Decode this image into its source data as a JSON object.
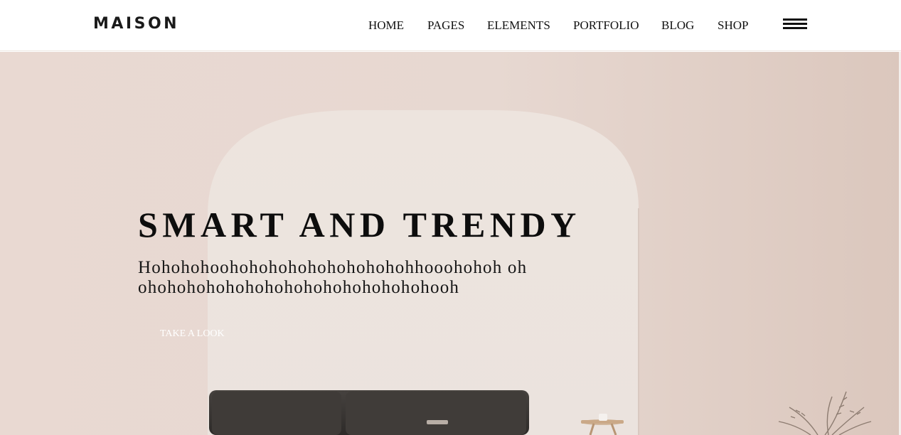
{
  "header": {
    "logo": "MAISON",
    "nav": [
      {
        "label": "HOME"
      },
      {
        "label": "PAGES"
      },
      {
        "label": "ELEMENTS"
      },
      {
        "label": "PORTFOLIO"
      },
      {
        "label": "BLOG"
      },
      {
        "label": "SHOP"
      }
    ],
    "menu_icon": "hamburger-menu-icon"
  },
  "hero": {
    "title": "SMART AND TRENDY",
    "subtitle": "Hohohohoohohohohohohohohohohhooohohoh ohohohohohohohohohohohohohohohohooh",
    "cta_label": "TAKE A LOOK"
  },
  "colors": {
    "background_wall": "#e6d6cf",
    "arch": "#ebe2dc",
    "sofa": "#3a3735",
    "text": "#111111"
  }
}
